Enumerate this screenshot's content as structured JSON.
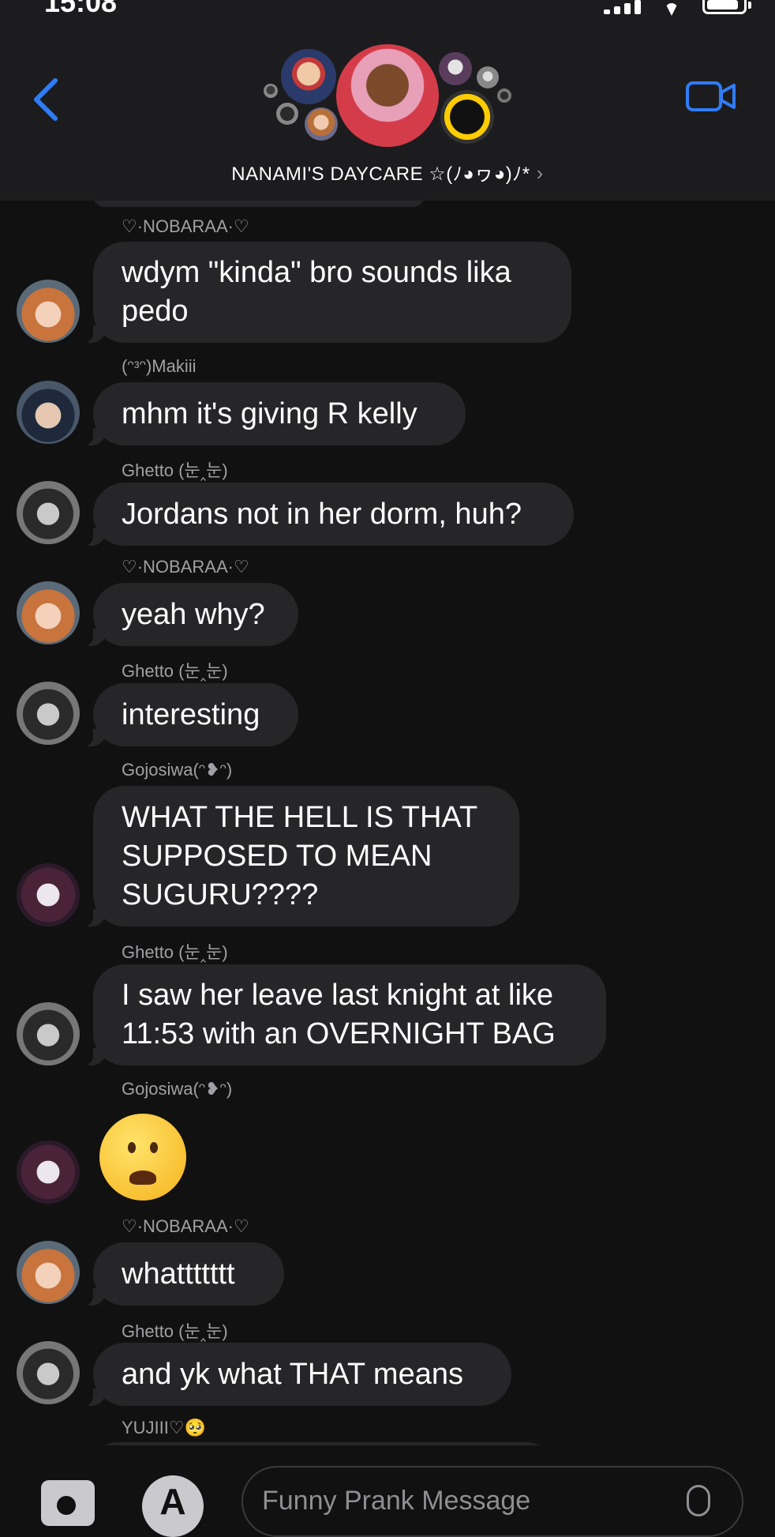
{
  "status_bar": {
    "time": "15:08"
  },
  "header": {
    "group_name": "NANAMI'S DAYCARE ☆(ﾉ◕ヮ◕)ﾉ*",
    "back_label": "back",
    "video_label": "video call"
  },
  "messages": [
    {
      "sender": "♡·NOBARAA·♡",
      "avatar": "nobara-avatar",
      "text_lines": [
        "wdym \"kinda\" bro sounds lika",
        "pedo"
      ]
    },
    {
      "sender": "(ᵔᵌᵔ)Makiii",
      "avatar": "maki-avatar",
      "text_lines": [
        "mhm it's giving R kelly"
      ]
    },
    {
      "sender": "Ghetto (눈‸눈)",
      "avatar": "ghetto-avatar",
      "text_lines": [
        "Jordans not in her dorm, huh?"
      ]
    },
    {
      "sender": "♡·NOBARAA·♡",
      "avatar": "nobara-avatar",
      "text_lines": [
        "yeah why?"
      ]
    },
    {
      "sender": "Ghetto (눈‸눈)",
      "avatar": "ghetto-avatar",
      "text_lines": [
        "interesting"
      ]
    },
    {
      "sender": "Gojosiwa(ᵔ❥ᵔ)",
      "avatar": "gojo-avatar",
      "text_lines": [
        "WHAT THE HELL IS THAT",
        "SUPPOSED TO MEAN",
        "SUGURU????"
      ]
    },
    {
      "sender": "Ghetto (눈‸눈)",
      "avatar": "ghetto-avatar",
      "text_lines": [
        "I saw her leave last knight at like",
        "11:53 with an OVERNIGHT BAG"
      ]
    },
    {
      "sender": "Gojosiwa(ᵔ❥ᵔ)",
      "avatar": "gojo-avatar",
      "emoji": "worried-face-emoji"
    },
    {
      "sender": "♡·NOBARAA·♡",
      "avatar": "nobara-avatar",
      "text_lines": [
        "whattttttt"
      ]
    },
    {
      "sender": "Ghetto (눈‸눈)",
      "avatar": "ghetto-avatar",
      "text_lines": [
        "and yk what THAT means"
      ]
    },
    {
      "sender": "YUJIII♡🥺",
      "avatar": "yuji-avatar",
      "text_lines": []
    }
  ],
  "composer": {
    "placeholder": "Funny Prank Message"
  }
}
